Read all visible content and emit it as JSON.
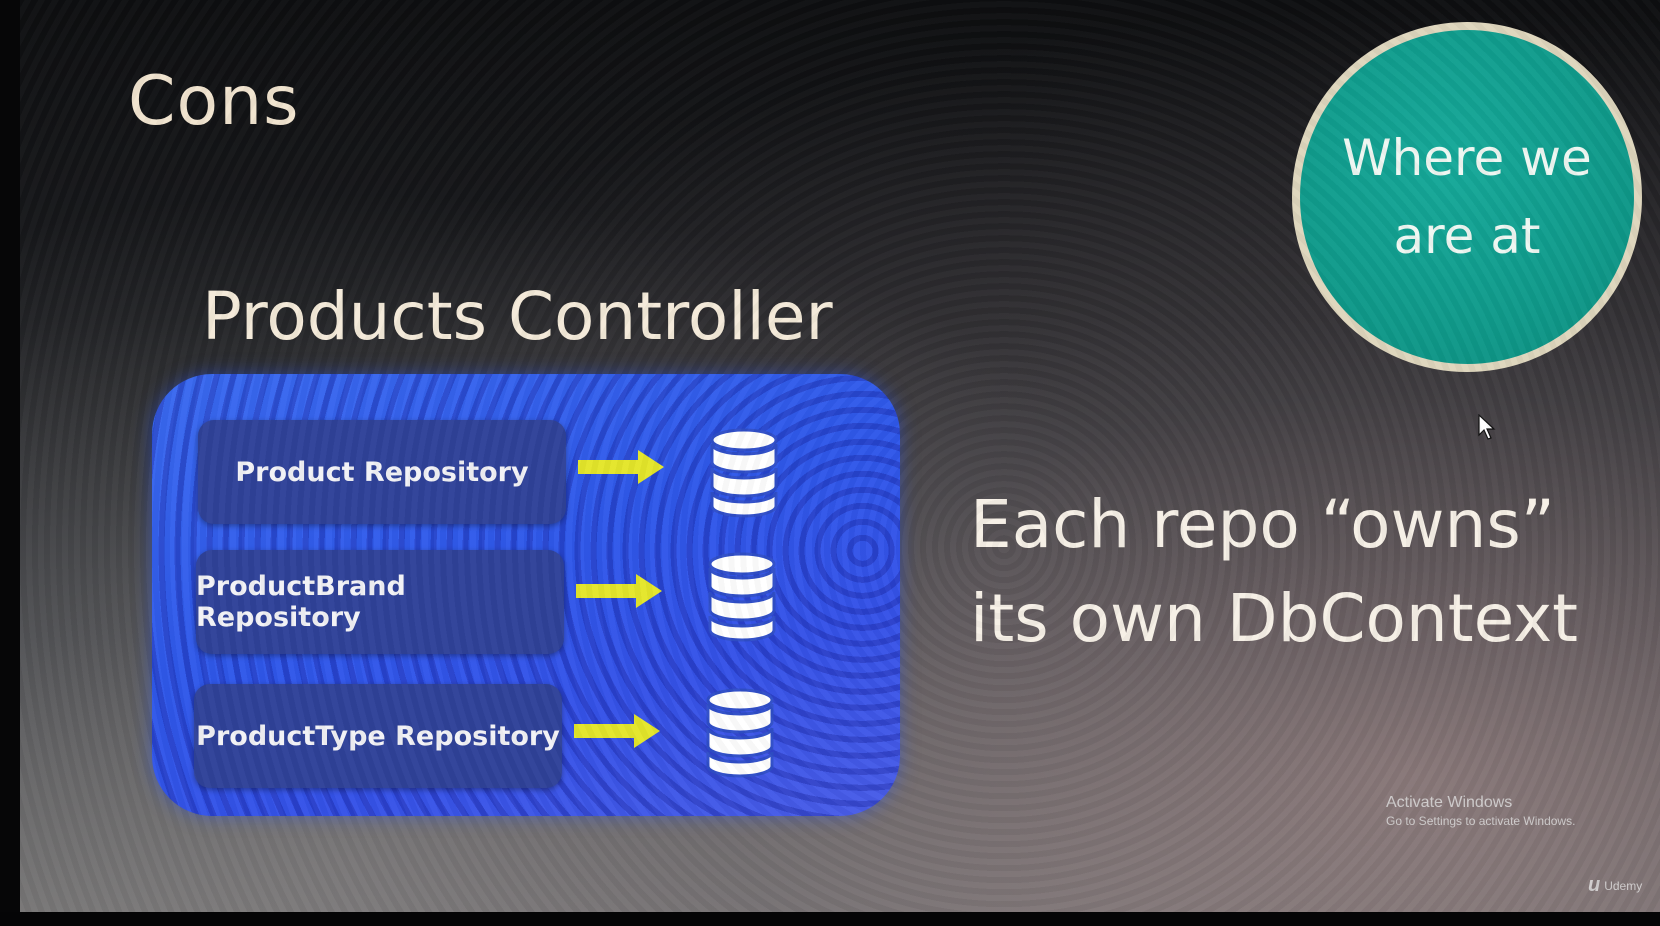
{
  "slide": {
    "title": "Cons",
    "diagram_title": "Products Controller",
    "repositories": [
      {
        "label": "Product Repository"
      },
      {
        "label": "ProductBrand Repository"
      },
      {
        "label": "ProductType Repository"
      }
    ],
    "badge": {
      "line1": "Where we",
      "line2": "are at"
    },
    "statement": {
      "line1": "Each repo “owns”",
      "line2": "its own DbContext"
    }
  },
  "watermark": {
    "activate_title": "Activate Windows",
    "activate_hint": "Go to Settings to activate Windows.",
    "brand": "Udemy"
  },
  "colors": {
    "panel_blue": "#3358ea",
    "repo_box": "#2f4299",
    "arrow_yellow": "#e4e62a",
    "badge_teal": "#119d8e",
    "badge_border": "#ded6bd"
  },
  "icons": {
    "arrow": "right-arrow-icon",
    "database": "database-icon",
    "cursor": "mouse-pointer-icon"
  }
}
